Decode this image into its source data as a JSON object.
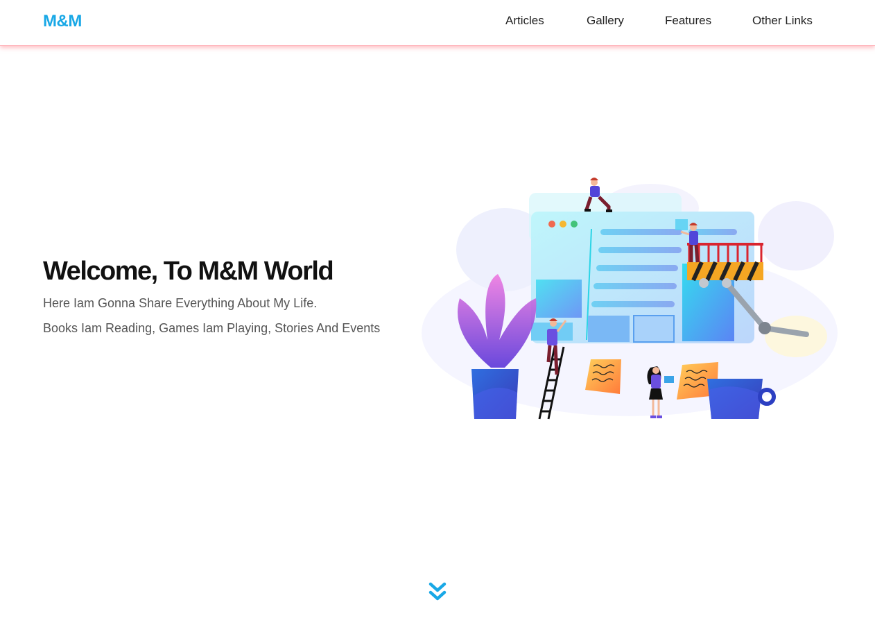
{
  "header": {
    "logo": "M&M",
    "nav": [
      {
        "label": "Articles"
      },
      {
        "label": "Gallery"
      },
      {
        "label": "Features"
      },
      {
        "label": "Other Links"
      }
    ]
  },
  "hero": {
    "title": "Welcome, To M&M World",
    "lines": [
      "Here Iam Gonna Share Everything About My Life.",
      "Books Iam Reading, Games Iam Playing, Stories And Events"
    ]
  },
  "icons": {
    "illustration": "website-building-illustration",
    "scroll": "double-chevron-down-icon"
  },
  "colors": {
    "brand": "#19a8e6",
    "header_shadow": "#ffb7bd",
    "text_dark": "#111111",
    "text_muted": "#555555"
  }
}
